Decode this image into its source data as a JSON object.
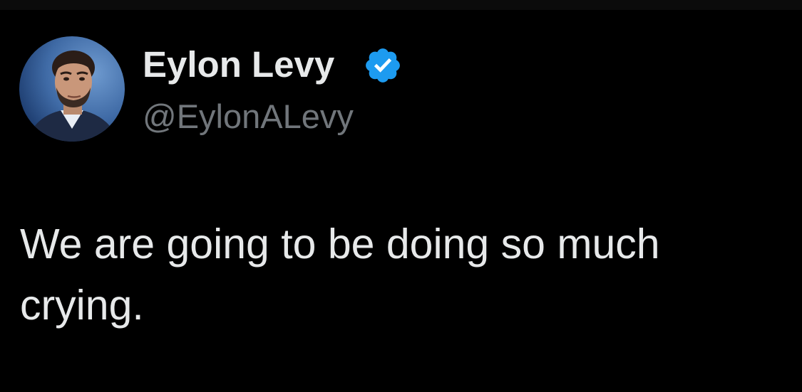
{
  "tweet": {
    "author": {
      "display_name": "Eylon Levy",
      "handle": "@EylonALevy",
      "verified": true,
      "avatar_icon": "profile-photo"
    },
    "text": "We are going to be doing so much crying."
  },
  "colors": {
    "background": "#000000",
    "primary_text": "#e7e9ea",
    "secondary_text": "#71767b",
    "verified_badge": "#1d9bf0"
  }
}
